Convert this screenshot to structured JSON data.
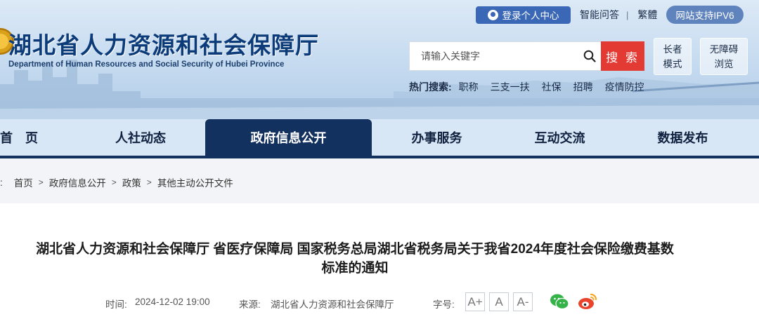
{
  "header": {
    "title": "湖北省人力资源和社会保障厅",
    "subtitle": "Department of Human Resources and Social Security of Hubei Province",
    "login_label": "登录个人中心",
    "links": [
      "智能问答",
      "繁體"
    ],
    "separator": "|",
    "ipv6_label": "网站支持IPV6",
    "search": {
      "placeholder": "请输入关键字",
      "button_label": "搜 索"
    },
    "elder_mode": {
      "line1": "长者",
      "line2": "模式"
    },
    "accessible_mode": {
      "line1": "无障碍",
      "line2": "浏览"
    },
    "hot_search": {
      "label": "热门搜索:",
      "items": [
        "职称",
        "三支一扶",
        "社保",
        "招聘",
        "疫情防控"
      ]
    }
  },
  "nav": {
    "items": [
      {
        "label": "首　页",
        "active": false
      },
      {
        "label": "人社动态",
        "active": false
      },
      {
        "label": "政府信息公开",
        "active": true
      },
      {
        "label": "办事服务",
        "active": false
      },
      {
        "label": "互动交流",
        "active": false
      },
      {
        "label": "数据发布",
        "active": false
      }
    ]
  },
  "breadcrumb": {
    "prefix": ":",
    "items": [
      "首页",
      "政府信息公开",
      "政策",
      "其他主动公开文件"
    ],
    "separator": ">"
  },
  "article": {
    "title_line1": "湖北省人力资源和社会保障厅 省医疗保障局 国家税务总局湖北省税务局关于我省2024年度社会保险缴费基数",
    "title_line2": "标准的通知",
    "time_label": "时间:",
    "time": "2024-12-02 19:00",
    "source_label": "来源:",
    "source": "湖北省人力资源和社会保障厅",
    "font_label": "字号:",
    "font_buttons": [
      "A+",
      "A",
      "A-"
    ]
  },
  "colors": {
    "nav_active": "#13315f",
    "search_button": "#e43a34",
    "login_button": "#3a67b6",
    "title_blue": "#0c3b7a"
  }
}
